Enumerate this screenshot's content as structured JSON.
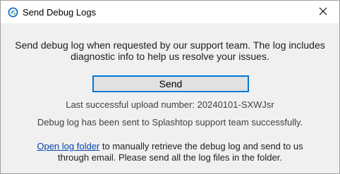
{
  "window": {
    "title": "Send Debug Logs",
    "icon": "splashtop-icon",
    "close_icon": "close-icon"
  },
  "content": {
    "description_line1": "Send debug log when requested by our support team. The log includes",
    "description_line2": "diagnostic info to help us resolve your issues.",
    "send_label": "Send",
    "last_upload": "Last successful upload number: 20240101-SXWJsr",
    "sent_status": "Debug log has been sent to Splashtop support team successfully.",
    "link_label": "Open log folder",
    "instructions_rest_line1": " to manually retrieve the debug log and send to us",
    "instructions_line2": "through email. Please send all the log files in the folder."
  },
  "colors": {
    "accent": "#0078d7",
    "link": "#0645ad",
    "background": "#f0f0f0"
  }
}
